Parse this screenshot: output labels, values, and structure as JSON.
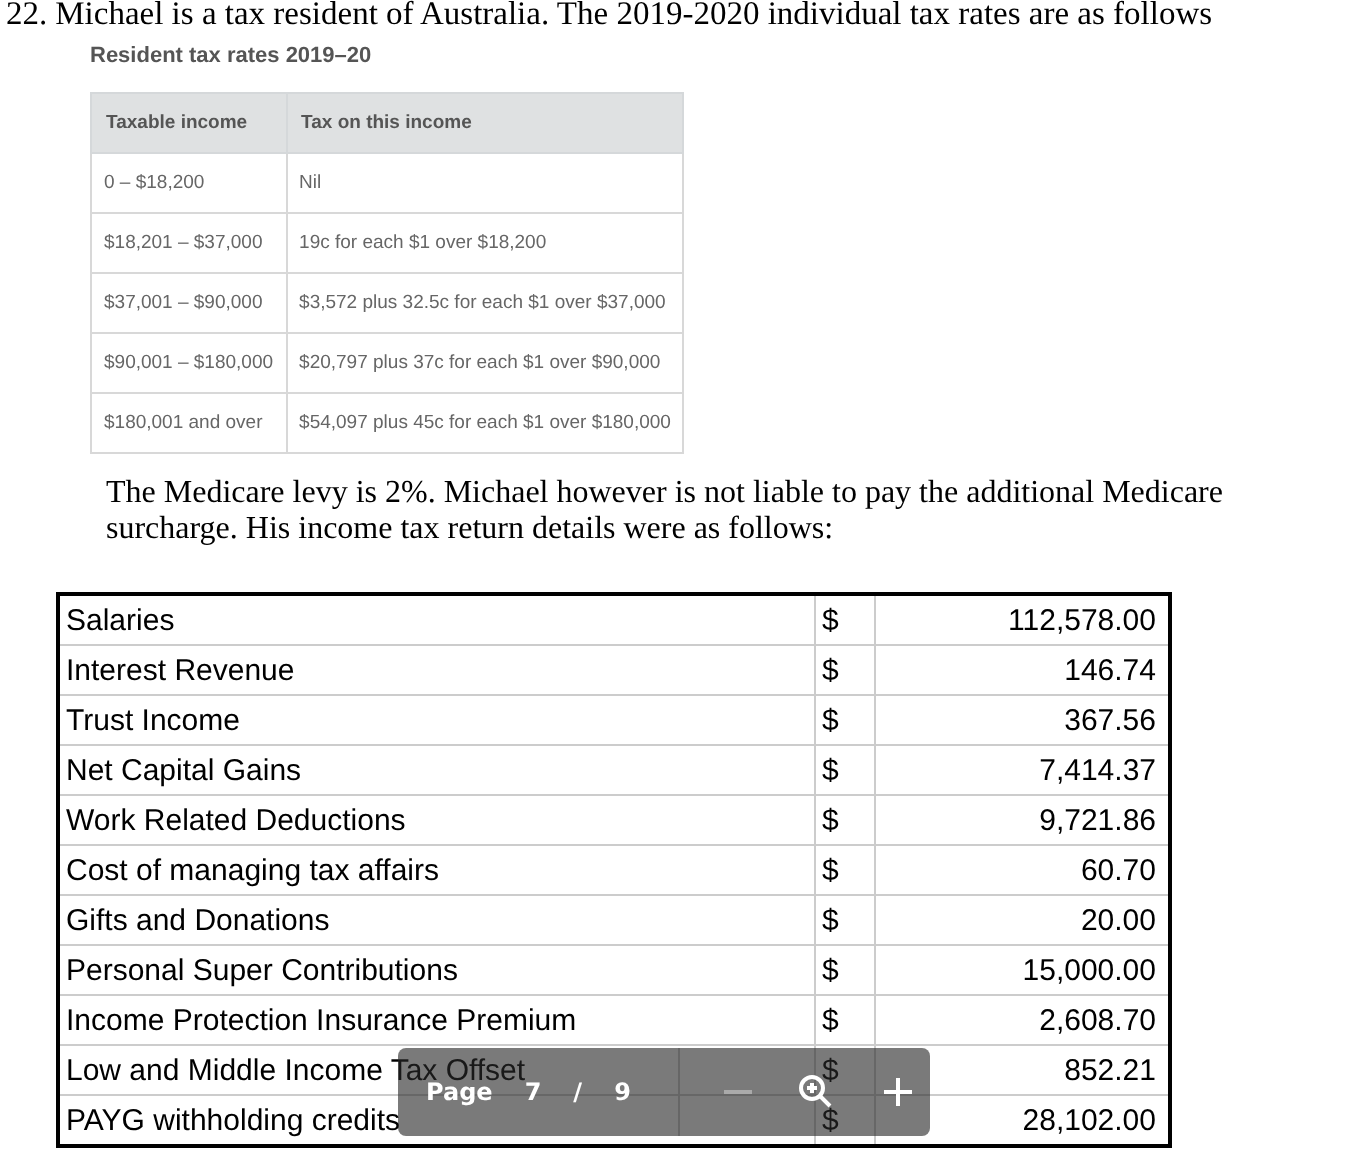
{
  "question": {
    "number": "22.",
    "text": "Michael is a tax resident of Australia. The 2019-2020 individual tax rates are as follows"
  },
  "rates_table": {
    "caption": "Resident tax rates 2019–20",
    "columns": [
      "Taxable income",
      "Tax on this income"
    ],
    "rows": [
      [
        "0 – $18,200",
        "Nil"
      ],
      [
        "$18,201 – $37,000",
        "19c for each $1 over $18,200"
      ],
      [
        "$37,001 – $90,000",
        "$3,572 plus 32.5c for each $1 over $37,000"
      ],
      [
        "$90,001 – $180,000",
        "$20,797 plus 37c for each $1 over $90,000"
      ],
      [
        "$180,001 and over",
        "$54,097 plus 45c for each $1 over $180,000"
      ]
    ]
  },
  "paragraph": "The Medicare levy is 2%. Michael however is not liable to pay the additional Medicare surcharge. His income tax return details were as follows:",
  "details_table": [
    {
      "item": "Salaries",
      "currency": "$",
      "amount": "112,578.00"
    },
    {
      "item": "Interest Revenue",
      "currency": "$",
      "amount": "146.74"
    },
    {
      "item": "Trust Income",
      "currency": "$",
      "amount": "367.56"
    },
    {
      "item": "Net Capital Gains",
      "currency": "$",
      "amount": "7,414.37"
    },
    {
      "item": "Work Related Deductions",
      "currency": "$",
      "amount": "9,721.86"
    },
    {
      "item": "Cost of managing tax affairs",
      "currency": "$",
      "amount": "60.70"
    },
    {
      "item": "Gifts and Donations",
      "currency": "$",
      "amount": "20.00"
    },
    {
      "item": "Personal Super Contributions",
      "currency": "$",
      "amount": "15,000.00"
    },
    {
      "item": "Income Protection Insurance Premium",
      "currency": "$",
      "amount": "2,608.70"
    },
    {
      "item": "Low and Middle Income Tax Offset",
      "currency": "$",
      "amount": "852.21"
    },
    {
      "item": "PAYG withholding credits",
      "currency": "$",
      "amount": "28,102.00"
    }
  ],
  "page_toolbar": {
    "label": "Page",
    "current": "7",
    "separator": "/",
    "total": "9"
  }
}
